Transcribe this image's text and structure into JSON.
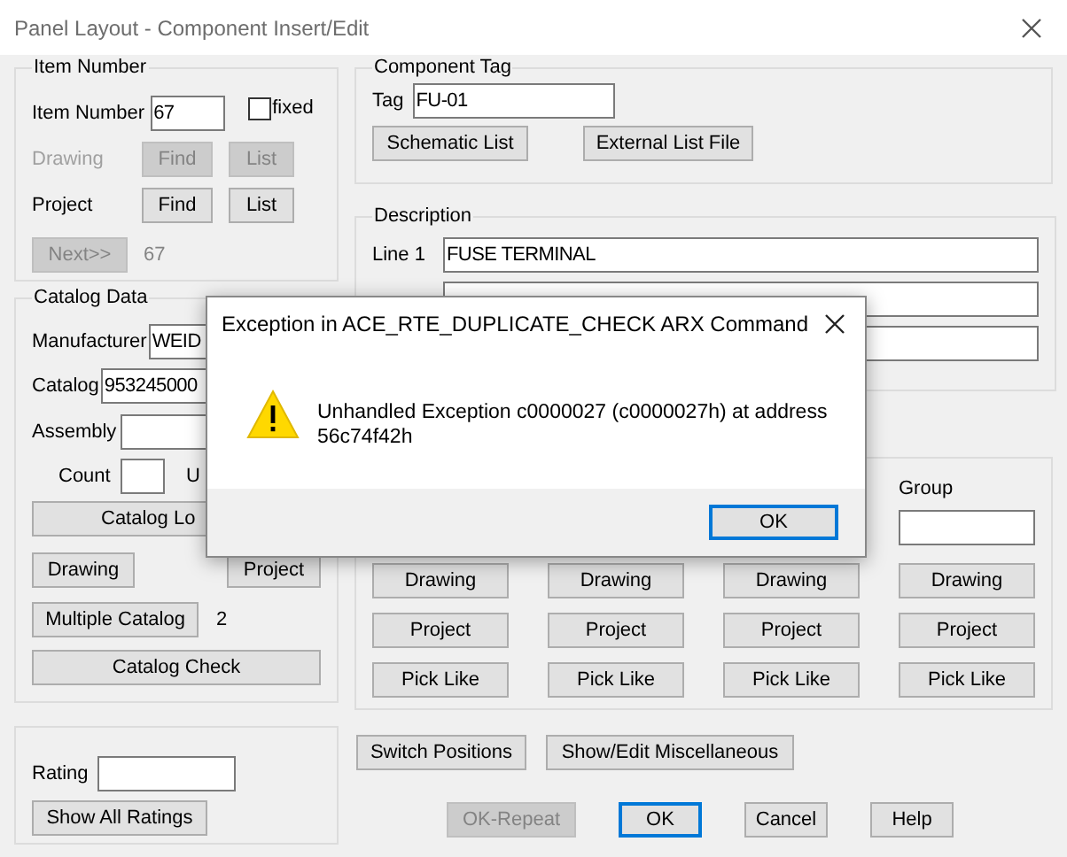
{
  "window": {
    "title": "Panel Layout - Component Insert/Edit"
  },
  "item_number": {
    "title": "Item Number",
    "label": "Item Number",
    "value": "67",
    "fixed": {
      "label": "fixed",
      "checked": false
    },
    "rows": [
      {
        "label": "Drawing",
        "disabled": true,
        "buttons": [
          "Find",
          "List"
        ]
      },
      {
        "label": "Project",
        "disabled": false,
        "buttons": [
          "Find",
          "List"
        ]
      }
    ],
    "next": {
      "label": "Next>>",
      "disabled": true
    },
    "next_value": "67"
  },
  "catalog_data": {
    "title": "Catalog Data",
    "manufacturer": {
      "label": "Manufacturer",
      "value": "WEID"
    },
    "catalog": {
      "label": "Catalog",
      "value": "953245000"
    },
    "assembly": {
      "label": "Assembly"
    },
    "count": {
      "label": "Count"
    },
    "unit_label": "U",
    "lookup_button": "Catalog Lo",
    "drawing_button": "Drawing",
    "project_button": "Project",
    "multiple_catalog_button": "Multiple Catalog",
    "multiple_count": "2",
    "check_button": "Catalog Check"
  },
  "rating": {
    "label": "Rating",
    "button": "Show All Ratings"
  },
  "component_tag": {
    "title": "Component Tag",
    "label": "Tag",
    "value": "FU-01",
    "buttons": [
      "Schematic List",
      "External List File"
    ]
  },
  "description": {
    "title": "Description",
    "lines": [
      {
        "kind": "labeled",
        "label": "Line 1",
        "value": "FUSE TERMINAL"
      },
      {
        "kind": "covered"
      },
      {
        "kind": "covered"
      }
    ]
  },
  "references": {
    "columns": [
      {
        "buttons": [
          "Drawing",
          "Project",
          "Pick Like"
        ]
      },
      {
        "buttons": [
          "Drawing",
          "Project",
          "Pick Like"
        ]
      },
      {
        "buttons": [
          "Drawing",
          "Project",
          "Pick Like"
        ]
      },
      {
        "title": "Group",
        "buttons": [
          "Drawing",
          "Project",
          "Pick Like"
        ]
      }
    ]
  },
  "actions": [
    "Switch Positions",
    "Show/Edit Miscellaneous"
  ],
  "footer_buttons": [
    {
      "label": "OK-Repeat",
      "disabled": true,
      "default": false
    },
    {
      "label": "OK",
      "disabled": false,
      "default": true
    },
    {
      "label": "Cancel",
      "disabled": false,
      "default": false
    },
    {
      "label": "Help",
      "disabled": false,
      "default": false
    }
  ],
  "error_dialog": {
    "title": "Exception in ACE_RTE_DUPLICATE_CHECK ARX Command",
    "message": "Unhandled Exception c0000027 (c0000027h) at address 56c74f42h",
    "button": {
      "label": "OK",
      "default": true
    }
  }
}
